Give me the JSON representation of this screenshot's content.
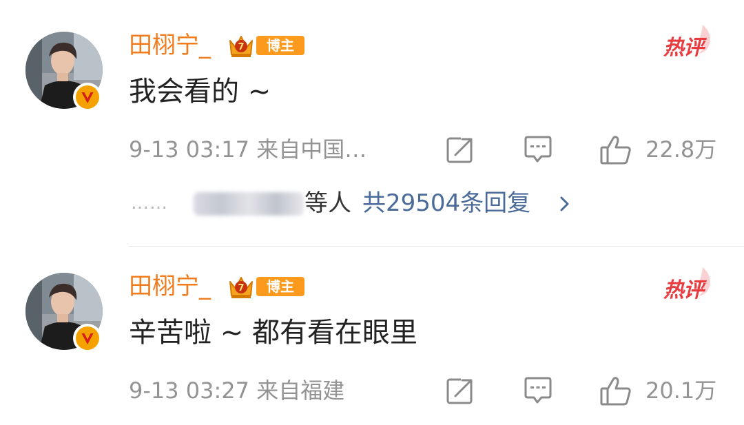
{
  "comments": [
    {
      "username": "田栩宁_",
      "badge_label": "博主",
      "hot_label": "热评",
      "text": "我会看的 ~",
      "meta": "9-13 03:17  来自中国…",
      "likes": "22.8万",
      "replies": {
        "dots": "……",
        "names_visible": "等人",
        "total": "共29504条回复"
      },
      "icons": [
        "avatar",
        "verified-v-icon",
        "crown-icon",
        "repost-icon",
        "reply-icon",
        "like-icon",
        "chevron-right-icon"
      ]
    },
    {
      "username": "田栩宁_",
      "badge_label": "博主",
      "hot_label": "热评",
      "text": "辛苦啦 ~ 都有看在眼里",
      "meta": "9-13 03:27  来自福建",
      "likes": "20.1万",
      "icons": [
        "avatar",
        "verified-v-icon",
        "crown-icon",
        "repost-icon",
        "reply-icon",
        "like-icon"
      ]
    }
  ],
  "colors": {
    "username": "#f07c1e",
    "badge": "#fb9a1d",
    "hot": "#e83b3f",
    "link": "#4a6a9a",
    "meta": "#939393",
    "verified": "#f5a200"
  }
}
